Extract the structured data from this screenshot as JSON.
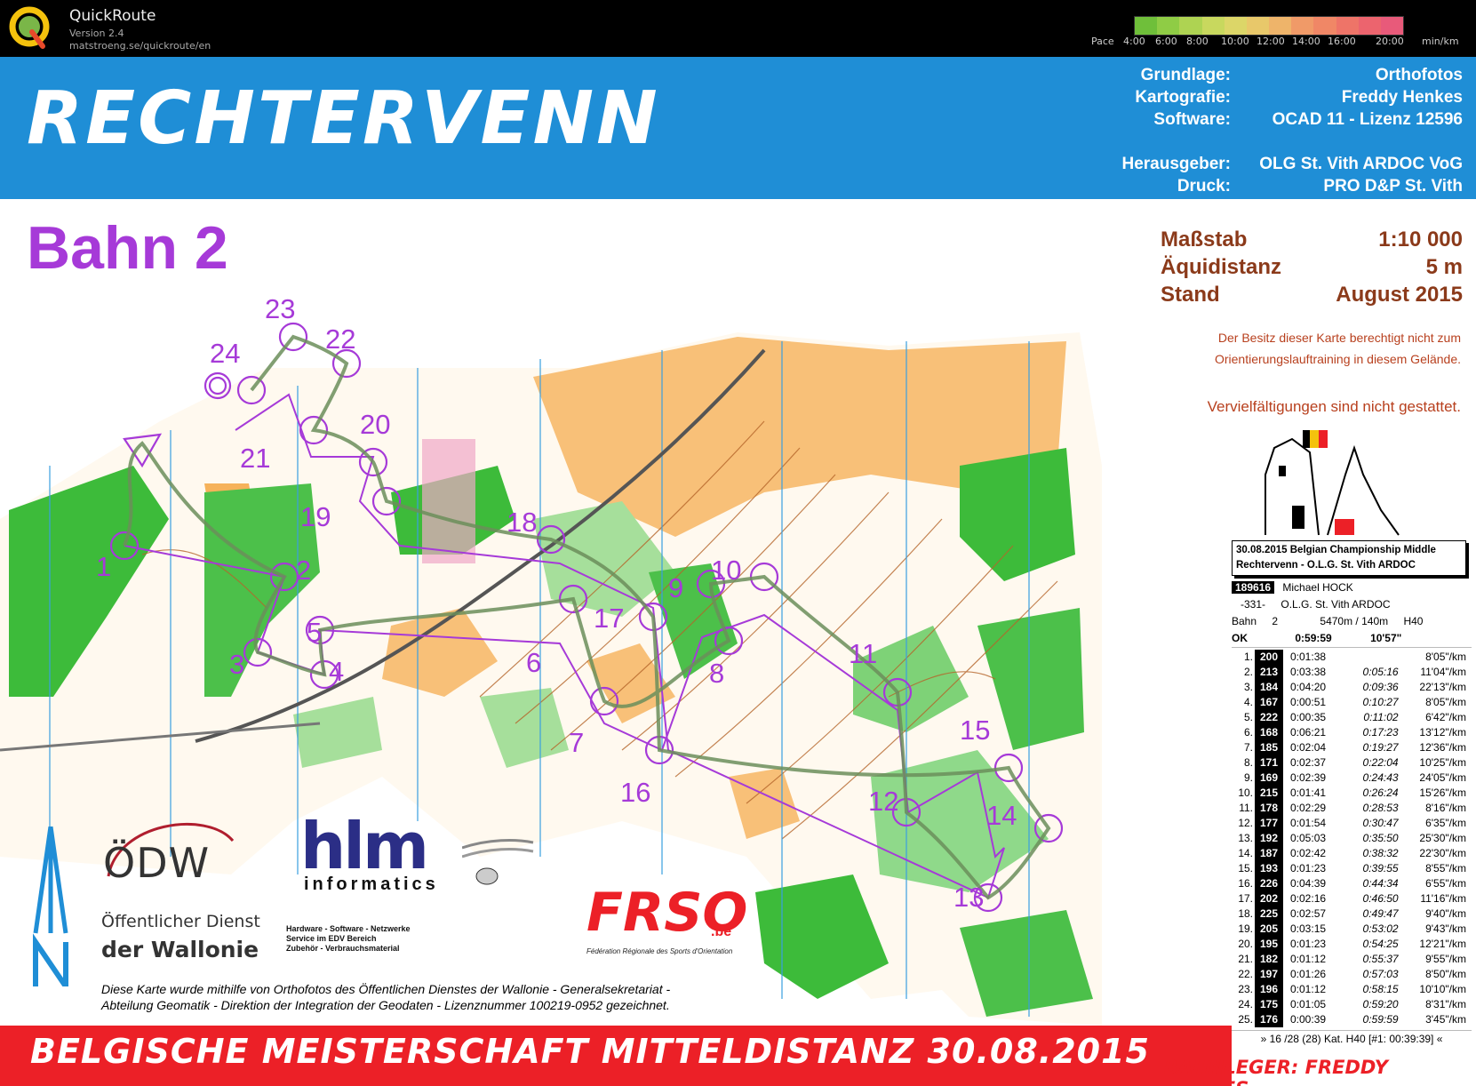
{
  "app": {
    "name": "QuickRoute",
    "version": "Version 2.4",
    "url": "matstroeng.se/quickroute/en"
  },
  "pace_scale": {
    "label": "Pace",
    "ticks": [
      "4:00",
      "6:00",
      "8:00",
      "10:00",
      "12:00",
      "14:00",
      "16:00",
      "20:00"
    ],
    "unit": "min/km",
    "colors": [
      "#6fbf3a",
      "#8fcc45",
      "#aed352",
      "#c8d85e",
      "#dcd668",
      "#e8c86a",
      "#eeb46a",
      "#f09a68",
      "#f08766",
      "#ee7468",
      "#ec646e",
      "#e85a7a"
    ]
  },
  "map": {
    "name": "RECHTERVENN",
    "credits": [
      {
        "key": "Grundlage:",
        "value": "Orthofotos"
      },
      {
        "key": "Kartografie:",
        "value": "Freddy Henkes"
      },
      {
        "key": "Software:",
        "value": "OCAD 11 - Lizenz 12596"
      },
      {
        "key": "",
        "value": ""
      },
      {
        "key": "Herausgeber:",
        "value": "OLG St. Vith ARDOC VoG"
      },
      {
        "key": "Druck:",
        "value": "PRO D&P St. Vith"
      }
    ],
    "course_title": "Bahn 2",
    "scale_rows": [
      {
        "key": "Maßstab",
        "value": "1:10 000"
      },
      {
        "key": "Äquidistanz",
        "value": "5 m"
      },
      {
        "key": "Stand",
        "value": "August 2015"
      }
    ],
    "notice_1": "Der Besitz dieser Karte berechtigt nicht zum",
    "notice_2": "Orientierungslauftraining in diesem Gelände.",
    "notice_3": "Vervielfältigungen sind nicht gestattet.",
    "sponsor_odw_logo": "ÖDW",
    "sponsor_odw_line1": "Öffentlicher Dienst",
    "sponsor_odw_line2": "der Wallonie",
    "sponsor_hlm_logo": "hlm",
    "sponsor_hlm_sub": "informatics",
    "sponsor_hlm_services": [
      "Hardware - Software - Netzwerke",
      "Service im EDV Bereich",
      "Zubehör - Verbrauchsmaterial"
    ],
    "sponsor_frso": "FRSO",
    "sponsor_frso_be": ".be",
    "sponsor_frso_sub": "Fédération Régionale des Sports d'Orientation",
    "disclaimer": "Diese Karte wurde mithilfe von Orthofotos des Öffentlichen Dienstes der Wallonie - Generalsekretariat - Abteilung Geomatik - Direktion der Integration der Geodaten - Lizenznummer 100219-0952 gezeichnet.",
    "bottom_title": "BELGISCHE MEISTERSCHAFT MITTELDISTANZ 30.08.2015",
    "course_setter": "BAHNLEGER: FREDDY HENKES",
    "control_numbers": [
      "1",
      "2",
      "3",
      "4",
      "5",
      "6",
      "7",
      "8",
      "9",
      "10",
      "11",
      "12",
      "13",
      "14",
      "15",
      "16",
      "17",
      "18",
      "19",
      "20",
      "21",
      "22",
      "23",
      "24"
    ]
  },
  "result": {
    "event_line1": "30.08.2015  Belgian Championship Middle",
    "event_line2": "Rechtervenn - O.L.G. St. Vith ARDOC",
    "bib": "189616",
    "runner": "Michael HOCK",
    "club_code": "-331-",
    "club": "O.L.G. St. Vith ARDOC",
    "course_label": "Bahn",
    "course_num": "2",
    "distance": "5470m / 140m",
    "category": "H40",
    "status": "OK",
    "total_time": "0:59:59",
    "pace": "10'57\"",
    "splits": [
      {
        "n": "1.",
        "code": "200",
        "split": "0:01:38",
        "cum": "",
        "pace": "8'05\"/km"
      },
      {
        "n": "2.",
        "code": "213",
        "split": "0:03:38",
        "cum": "0:05:16",
        "pace": "11'04\"/km"
      },
      {
        "n": "3.",
        "code": "184",
        "split": "0:04:20",
        "cum": "0:09:36",
        "pace": "22'13\"/km"
      },
      {
        "n": "4.",
        "code": "167",
        "split": "0:00:51",
        "cum": "0:10:27",
        "pace": "8'05\"/km"
      },
      {
        "n": "5.",
        "code": "222",
        "split": "0:00:35",
        "cum": "0:11:02",
        "pace": "6'42\"/km"
      },
      {
        "n": "6.",
        "code": "168",
        "split": "0:06:21",
        "cum": "0:17:23",
        "pace": "13'12\"/km"
      },
      {
        "n": "7.",
        "code": "185",
        "split": "0:02:04",
        "cum": "0:19:27",
        "pace": "12'36\"/km"
      },
      {
        "n": "8.",
        "code": "171",
        "split": "0:02:37",
        "cum": "0:22:04",
        "pace": "10'25\"/km"
      },
      {
        "n": "9.",
        "code": "169",
        "split": "0:02:39",
        "cum": "0:24:43",
        "pace": "24'05\"/km"
      },
      {
        "n": "10.",
        "code": "215",
        "split": "0:01:41",
        "cum": "0:26:24",
        "pace": "15'26\"/km"
      },
      {
        "n": "11.",
        "code": "178",
        "split": "0:02:29",
        "cum": "0:28:53",
        "pace": "8'16\"/km"
      },
      {
        "n": "12.",
        "code": "177",
        "split": "0:01:54",
        "cum": "0:30:47",
        "pace": "6'35\"/km"
      },
      {
        "n": "13.",
        "code": "192",
        "split": "0:05:03",
        "cum": "0:35:50",
        "pace": "25'30\"/km"
      },
      {
        "n": "14.",
        "code": "187",
        "split": "0:02:42",
        "cum": "0:38:32",
        "pace": "22'30\"/km"
      },
      {
        "n": "15.",
        "code": "193",
        "split": "0:01:23",
        "cum": "0:39:55",
        "pace": "8'55\"/km"
      },
      {
        "n": "16.",
        "code": "226",
        "split": "0:04:39",
        "cum": "0:44:34",
        "pace": "6'55\"/km"
      },
      {
        "n": "17.",
        "code": "202",
        "split": "0:02:16",
        "cum": "0:46:50",
        "pace": "11'16\"/km"
      },
      {
        "n": "18.",
        "code": "225",
        "split": "0:02:57",
        "cum": "0:49:47",
        "pace": "9'40\"/km"
      },
      {
        "n": "19.",
        "code": "205",
        "split": "0:03:15",
        "cum": "0:53:02",
        "pace": "9'43\"/km"
      },
      {
        "n": "20.",
        "code": "195",
        "split": "0:01:23",
        "cum": "0:54:25",
        "pace": "12'21\"/km"
      },
      {
        "n": "21.",
        "code": "182",
        "split": "0:01:12",
        "cum": "0:55:37",
        "pace": "9'55\"/km"
      },
      {
        "n": "22.",
        "code": "197",
        "split": "0:01:26",
        "cum": "0:57:03",
        "pace": "8'50\"/km"
      },
      {
        "n": "23.",
        "code": "196",
        "split": "0:01:12",
        "cum": "0:58:15",
        "pace": "10'10\"/km"
      },
      {
        "n": "24.",
        "code": "175",
        "split": "0:01:05",
        "cum": "0:59:20",
        "pace": "8'31\"/km"
      },
      {
        "n": "25.",
        "code": "176",
        "split": "0:00:39",
        "cum": "0:59:59",
        "pace": "3'45\"/km"
      }
    ],
    "ranking": "» 16 /28 (28) Kat. H40 [#1: 00:39:39] «"
  }
}
